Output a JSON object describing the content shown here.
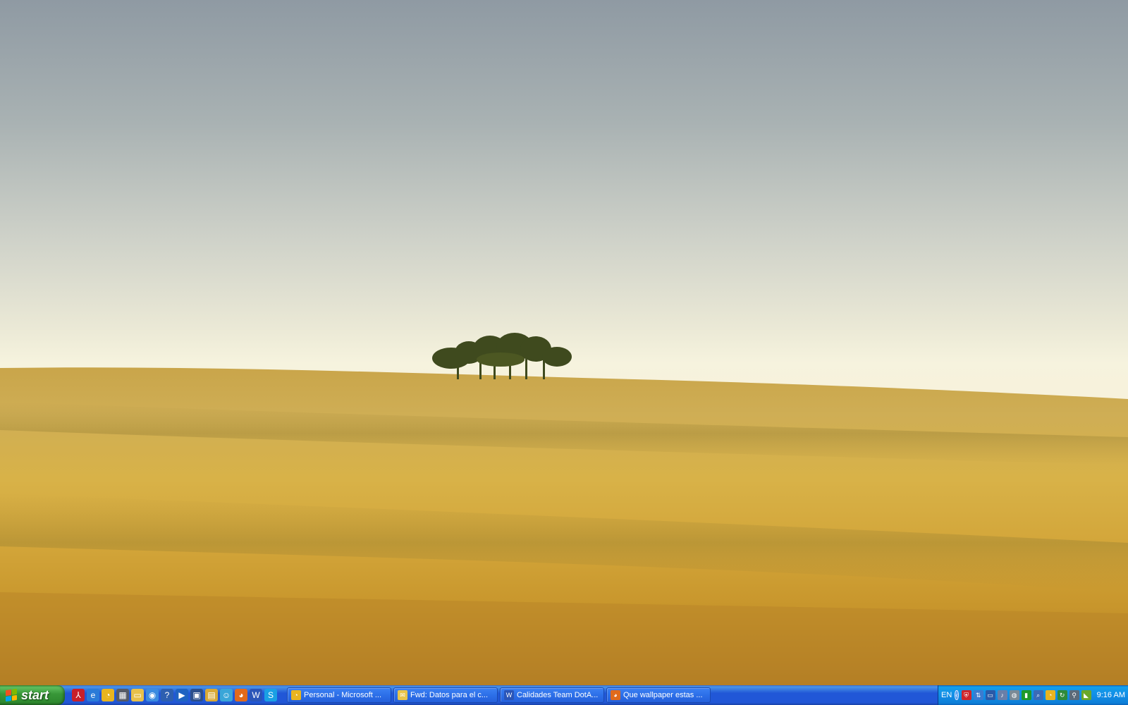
{
  "desktop": {
    "wallpaper": "golden-wheat-field-with-trees",
    "colors": {
      "sky_top": "#8f9aa3",
      "sky_horizon": "#f7f2dc",
      "field_light": "#d9b347",
      "field_dark": "#b8862a"
    }
  },
  "taskbar": {
    "start_label": "start",
    "quicklaunch": [
      {
        "icon": "acrobat-icon",
        "glyph": "⅄",
        "color": "#c8202a"
      },
      {
        "icon": "internet-explorer-icon",
        "glyph": "e",
        "color": "#2a7bd8"
      },
      {
        "icon": "outlook-icon",
        "glyph": "◔",
        "color": "#e9b41f"
      },
      {
        "icon": "calculator-icon",
        "glyph": "▦",
        "color": "#555a66"
      },
      {
        "icon": "folder-icon",
        "glyph": "▭",
        "color": "#e8c04a"
      },
      {
        "icon": "ie-globe-icon",
        "glyph": "◉",
        "color": "#3b8be0"
      },
      {
        "icon": "help-icon",
        "glyph": "?",
        "color": "#2d5fb0"
      },
      {
        "icon": "media-player-icon",
        "glyph": "▶",
        "color": "#1f63c2"
      },
      {
        "icon": "show-desktop-icon",
        "glyph": "▣",
        "color": "#2c4f8c"
      },
      {
        "icon": "windows-explorer-icon",
        "glyph": "▤",
        "color": "#d9a936"
      },
      {
        "icon": "messenger-icon",
        "glyph": "☺",
        "color": "#3aa6d8"
      },
      {
        "icon": "firefox-icon",
        "glyph": "◕",
        "color": "#e06a1c"
      },
      {
        "icon": "word-icon",
        "glyph": "W",
        "color": "#2a55b8"
      },
      {
        "icon": "skype-icon",
        "glyph": "S",
        "color": "#1aa0e4"
      }
    ],
    "tasks": [
      {
        "label": "Personal - Microsoft ...",
        "icon": "outlook-icon",
        "glyph": "◔",
        "color": "#e9b41f"
      },
      {
        "label": "Fwd: Datos para el c...",
        "icon": "mail-icon",
        "glyph": "✉",
        "color": "#e8c44a"
      },
      {
        "label": "Calidades Team DotA...",
        "icon": "word-icon",
        "glyph": "W",
        "color": "#2a55b8"
      },
      {
        "label": "Que wallpaper estas ...",
        "icon": "firefox-icon",
        "glyph": "◕",
        "color": "#e06a1c"
      }
    ],
    "tray": {
      "language": "EN",
      "chevron": "‹",
      "icons": [
        {
          "icon": "antivirus-icon",
          "glyph": "⛨",
          "color": "#d0262a"
        },
        {
          "icon": "network-icon",
          "glyph": "⇅",
          "color": "#3b7bd0"
        },
        {
          "icon": "monitor-icon",
          "glyph": "▭",
          "color": "#2a5aa8"
        },
        {
          "icon": "volume-icon",
          "glyph": "♪",
          "color": "#6a7fa8"
        },
        {
          "icon": "security-icon",
          "glyph": "◍",
          "color": "#7a8a96"
        },
        {
          "icon": "signal-icon",
          "glyph": "▮",
          "color": "#1e9a2a"
        },
        {
          "icon": "search-icon",
          "glyph": "⌕",
          "color": "#3a6ab8"
        },
        {
          "icon": "outlook-tray-icon",
          "glyph": "◔",
          "color": "#e9b41f"
        },
        {
          "icon": "update-icon",
          "glyph": "↻",
          "color": "#2e8a3a"
        },
        {
          "icon": "usb-icon",
          "glyph": "⚲",
          "color": "#5a6a7a"
        },
        {
          "icon": "nvidia-icon",
          "glyph": "◣",
          "color": "#6aa82a"
        }
      ],
      "clock": "9:16 AM"
    }
  }
}
